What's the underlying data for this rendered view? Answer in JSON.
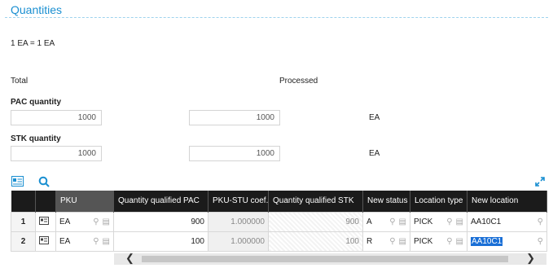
{
  "section": {
    "title": "Quantities"
  },
  "conversion": "1 EA = 1 EA",
  "labels": {
    "total": "Total",
    "processed": "Processed",
    "pac": "PAC quantity",
    "stk": "STK quantity"
  },
  "pac": {
    "total": "1000",
    "processed": "1000",
    "unit": "EA"
  },
  "stk": {
    "total": "1000",
    "processed": "1000",
    "unit": "EA"
  },
  "grid": {
    "columns": [
      "PKU",
      "Quantity qualified PAC",
      "PKU-STU coef.",
      "Quantity qualified STK",
      "New status",
      "Location type",
      "New location"
    ],
    "rows": [
      {
        "no": "1",
        "pku": "EA",
        "qty_pac": "900",
        "coef": "1.000000",
        "qty_stk": "900",
        "status": "A",
        "loc_type": "PICK",
        "new_loc": "AA10C1"
      },
      {
        "no": "2",
        "pku": "EA",
        "qty_pac": "100",
        "coef": "1.000000",
        "qty_stk": "100",
        "status": "R",
        "loc_type": "PICK",
        "new_loc": "AA10C1"
      }
    ]
  },
  "colors": {
    "accent": "#1a8fd1",
    "header_bg": "#1b1b1b",
    "selection": "#1a6fd6"
  }
}
